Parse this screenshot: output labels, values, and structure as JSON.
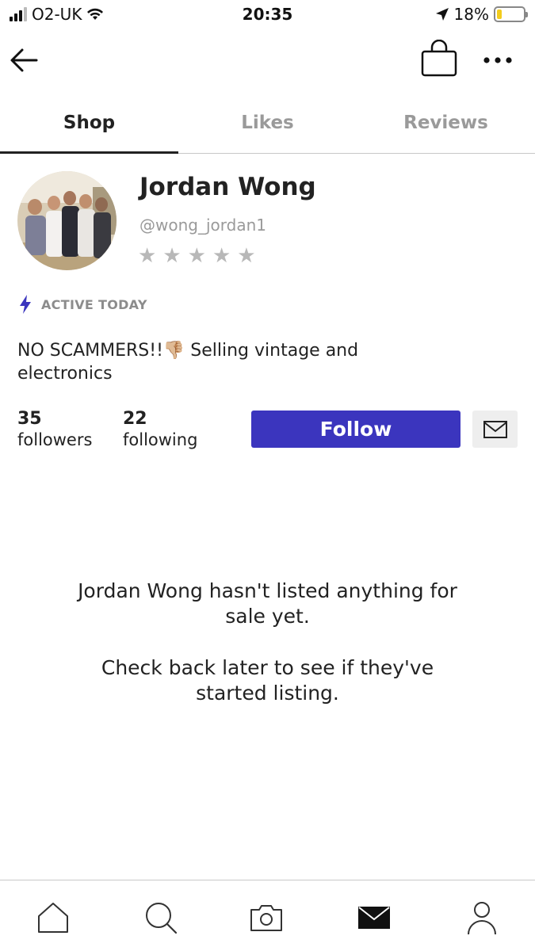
{
  "status_bar": {
    "carrier": "O2-UK",
    "time": "20:35",
    "battery_percent": "18%",
    "battery_level": 0.18,
    "icons": [
      "signal-icon",
      "wifi-icon",
      "location-icon",
      "battery-icon"
    ]
  },
  "nav": {
    "icons": [
      "back-arrow-icon",
      "shopping-bag-icon",
      "more-dots-icon"
    ]
  },
  "tabs": [
    {
      "label": "Shop",
      "active": true
    },
    {
      "label": "Likes",
      "active": false
    },
    {
      "label": "Reviews",
      "active": false
    }
  ],
  "profile": {
    "name": "Jordan Wong",
    "handle": "@wong_jordan1",
    "rating": 0,
    "rating_max": 5,
    "active_status": "ACTIVE TODAY",
    "bio_line1": "NO SCAMMERS!!👎🏼 Selling vintage and",
    "bio_line2": "electronics",
    "followers_count": "35",
    "followers_label": "followers",
    "following_count": "22",
    "following_label": "following",
    "follow_button": "Follow",
    "message_icon": "envelope-icon"
  },
  "empty_state": {
    "line1": "Jordan Wong hasn't listed anything for",
    "line2": "sale yet.",
    "line3": "Check back later to see if they've",
    "line4": "started listing."
  },
  "bottom_nav": {
    "icons": [
      "home-icon",
      "search-icon",
      "camera-icon",
      "inbox-icon",
      "profile-icon"
    ]
  },
  "colors": {
    "accent": "#3b35be",
    "active_icon": "#3b35be",
    "muted_text": "#9a9a9a",
    "battery": "#f2cc1d"
  }
}
